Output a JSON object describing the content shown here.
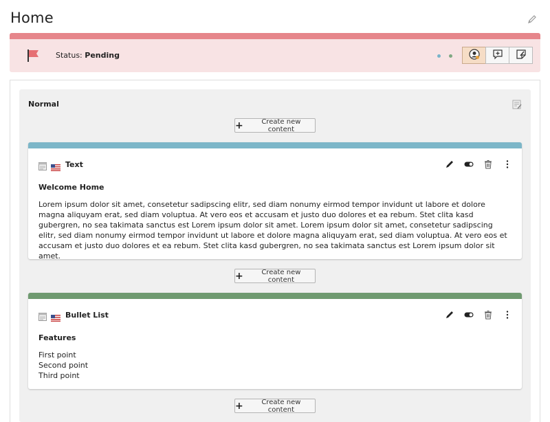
{
  "page": {
    "title": "Home"
  },
  "workspace": {
    "status_label": "Status:",
    "status_value": "Pending",
    "bar_color": "#e6868b",
    "background_color": "#f8e3e4",
    "icons": [
      "flag-icon",
      "user-assign-icon",
      "comment-icon",
      "note-icon"
    ]
  },
  "column": {
    "title": "Normal",
    "create_label": "Create new content"
  },
  "content_elements": [
    {
      "title": "Text",
      "bar_color": "#7cb6c8",
      "heading": "Welcome Home",
      "body": "Lorem ipsum dolor sit amet, consetetur sadipscing elitr, sed diam nonumy eirmod tempor invidunt ut labore et dolore magna aliquyam erat, sed diam voluptua. At vero eos et accusam et justo duo dolores et ea rebum. Stet clita kasd gubergren, no sea takimata sanctus est Lorem ipsum dolor sit amet. Lorem ipsum dolor sit amet, consetetur sadipscing elitr, sed diam nonumy eirmod tempor invidunt ut labore et dolore magna aliquyam erat, sed diam voluptua. At vero eos et accusam et justo duo dolores et ea rebum. Stet clita kasd gubergren, no sea takimata sanctus est Lorem ipsum dolor sit amet."
    },
    {
      "title": "Bullet List",
      "bar_color": "#6f9a70",
      "heading": "Features",
      "items": [
        "First point",
        "Second point",
        "Third point"
      ]
    }
  ]
}
